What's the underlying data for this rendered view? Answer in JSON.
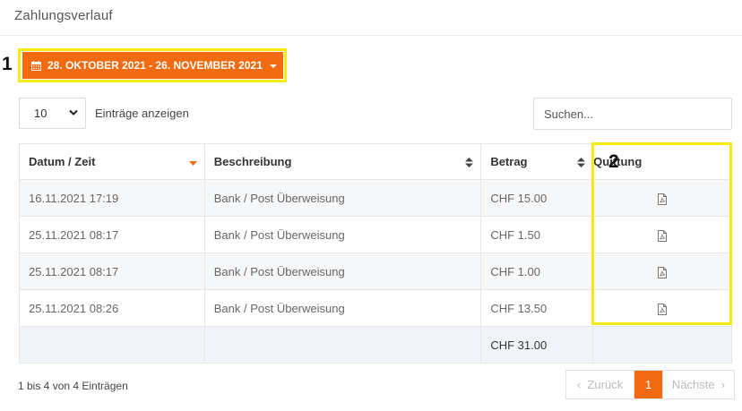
{
  "page": {
    "title": "Zahlungsverlauf"
  },
  "date_range": {
    "label": "28. OKTOBER 2021 - 26. NOVEMBER 2021",
    "icon": "calendar-icon",
    "accent": "#f26b10"
  },
  "annotations": {
    "one": "1",
    "two": "2",
    "highlight_color": "#f7ea12"
  },
  "length_menu": {
    "value": "10",
    "label": "Einträge anzeigen"
  },
  "search": {
    "placeholder": "Suchen..."
  },
  "table": {
    "headers": {
      "datum": "Datum / Zeit",
      "beschreibung": "Beschreibung",
      "betrag": "Betrag",
      "quittung": "Quittung"
    },
    "rows": [
      {
        "datum": "16.11.2021 17:19",
        "beschreibung": "Bank / Post Überweisung",
        "betrag": "CHF 15.00",
        "receipt_icon": "pdf-icon"
      },
      {
        "datum": "25.11.2021 08:17",
        "beschreibung": "Bank / Post Überweisung",
        "betrag": "CHF 1.50",
        "receipt_icon": "pdf-icon"
      },
      {
        "datum": "25.11.2021 08:17",
        "beschreibung": "Bank / Post Überweisung",
        "betrag": "CHF 1.00",
        "receipt_icon": "pdf-icon"
      },
      {
        "datum": "25.11.2021 08:26",
        "beschreibung": "Bank / Post Überweisung",
        "betrag": "CHF 13.50",
        "receipt_icon": "pdf-icon"
      }
    ],
    "total": "CHF 31.00"
  },
  "footer": {
    "info": "1 bis 4 von 4 Einträgen"
  },
  "pagination": {
    "prev": "Zurück",
    "current": "1",
    "next": "Nächste"
  }
}
